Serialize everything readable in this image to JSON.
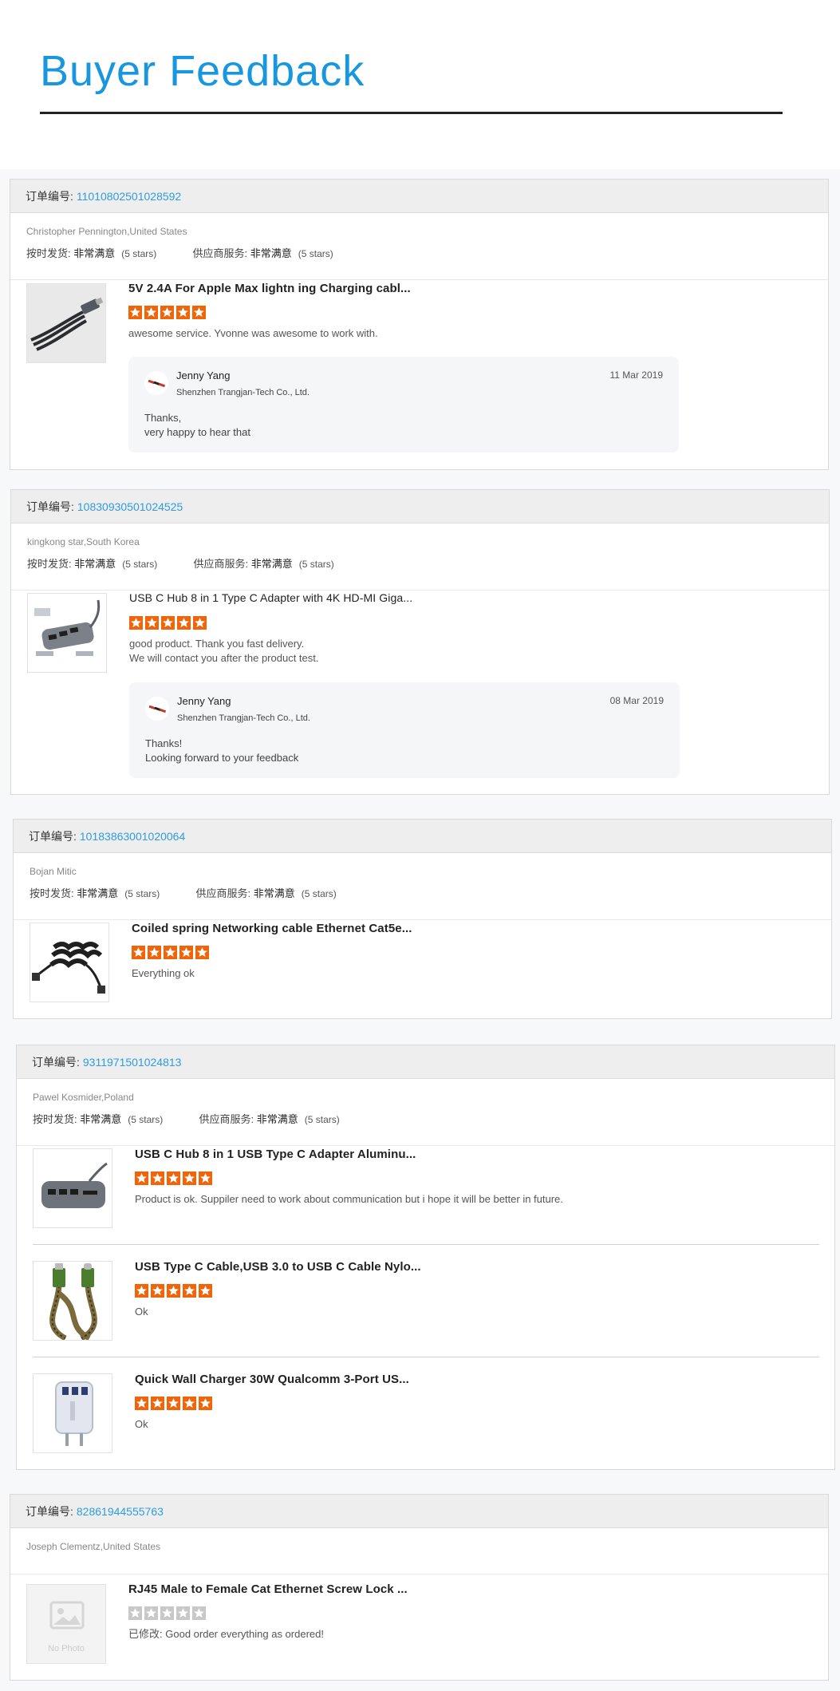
{
  "header": {
    "title": "Buyer Feedback"
  },
  "labels": {
    "order_prefix": "订单编号:",
    "on_time": "按时发货:",
    "supplier_service": "供应商服务:"
  },
  "colors": {
    "title_blue": "#1896de",
    "order_link": "#2e9ce0",
    "star_orange": "#f0640a",
    "star_gray": "#c8c8c8"
  },
  "orders": [
    {
      "order_no": "11010802501028592",
      "buyer": "Christopher Pennington,United States",
      "on_time_value": "非常满意",
      "on_time_stars": "(5 stars)",
      "service_value": "非常满意",
      "service_stars": "(5 stars)",
      "items": [
        {
          "title": "5V 2.4A For Apple Max lightn ing Charging cabl...",
          "rating": 5,
          "image": "coiled-usb-cable",
          "comment": [
            "awesome service. Yvonne was awesome to work with."
          ]
        }
      ],
      "reply": {
        "name": "Jenny Yang",
        "company": "Shenzhen Trangjan-Tech Co., Ltd.",
        "date": "11 Mar 2019",
        "text": [
          "Thanks,",
          "very happy to hear that"
        ]
      }
    },
    {
      "order_no": "10830930501024525",
      "buyer": "kingkong star,South Korea",
      "on_time_value": "非常满意",
      "on_time_stars": "(5 stars)",
      "service_value": "非常满意",
      "service_stars": "(5 stars)",
      "items": [
        {
          "title": "USB C Hub 8 in 1 Type C Adapter with 4K HD-MI Giga...",
          "rating": 5,
          "image": "usb-c-hub",
          "comment": [
            "good product. Thank you fast delivery.",
            "We will contact you after the product test."
          ]
        }
      ],
      "reply": {
        "name": "Jenny Yang",
        "company": "Shenzhen Trangjan-Tech Co., Ltd.",
        "date": "08 Mar 2019",
        "text": [
          "Thanks!",
          "Looking forward to your feedback"
        ]
      }
    },
    {
      "order_no": "10183863001020064",
      "buyer": "Bojan Mitic",
      "on_time_value": "非常满意",
      "on_time_stars": "(5 stars)",
      "service_value": "非常满意",
      "service_stars": "(5 stars)",
      "items": [
        {
          "title": "Coiled spring Networking cable Ethernet Cat5e...",
          "rating": 5,
          "image": "coiled-ethernet-cable",
          "comment": [
            "Everything ok"
          ]
        }
      ]
    },
    {
      "order_no": "9311971501024813",
      "buyer": "Pawel Kosmider,Poland",
      "on_time_value": "非常满意",
      "on_time_stars": "(5 stars)",
      "service_value": "非常满意",
      "service_stars": "(5 stars)",
      "items": [
        {
          "title": "USB C Hub 8 in 1 USB Type C Adapter Aluminu...",
          "rating": 5,
          "image": "usb-c-hub-gray",
          "comment": [
            "Product is ok. Suppiler need to work about communication but i hope it will be better in future."
          ]
        },
        {
          "title": "USB Type C Cable,USB 3.0 to USB C Cable Nylo...",
          "rating": 5,
          "image": "braided-usb-cable",
          "comment": [
            "Ok"
          ]
        },
        {
          "title": "Quick Wall Charger 30W Qualcomm 3-Port US...",
          "rating": 5,
          "image": "wall-charger",
          "comment": [
            "Ok"
          ]
        }
      ]
    },
    {
      "order_no": "82861944555763",
      "buyer": "Joseph Clementz,United States",
      "items": [
        {
          "title": "RJ45 Male to Female Cat Ethernet Screw Lock ...",
          "rating": 0,
          "image": "no-photo",
          "no_photo_text": "No Photo",
          "comment_prefix": "已修改:",
          "comment": [
            "Good order everything as ordered!"
          ]
        }
      ]
    }
  ]
}
